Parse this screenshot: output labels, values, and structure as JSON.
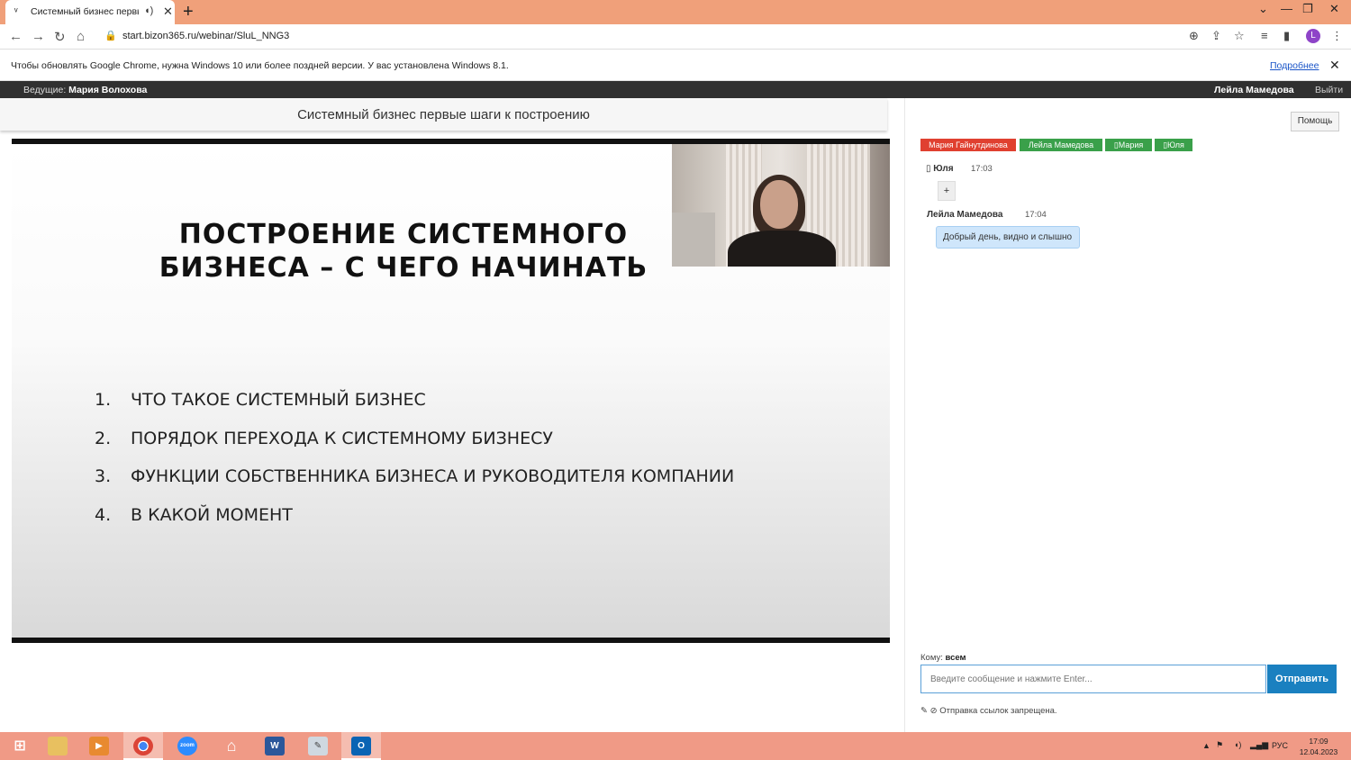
{
  "browser": {
    "tab_title": "Системный бизнес первые",
    "url": "start.bizon365.ru/webinar/SluL_NNG3",
    "profile_initial": "L",
    "infobar_message": "Чтобы обновлять Google Chrome, нужна Windows 10 или более поздней версии. У вас установлена Windows 8.1.",
    "infobar_link": "Подробнее"
  },
  "webinar_header": {
    "host_label": "Ведущие:",
    "host_name": "Мария Волохова",
    "current_user": "Лейла Мамедова",
    "exit_label": "Выйти"
  },
  "webinar_title": "Системный бизнес первые шаги к построению",
  "slide": {
    "heading_line1": "ПОСТРОЕНИЕ СИСТЕМНОГО",
    "heading_line2": "БИЗНЕСА – С ЧЕГО НАЧИНАТЬ",
    "items": [
      {
        "num": "1.",
        "text": "ЧТО ТАКОЕ СИСТЕМНЫЙ БИЗНЕС"
      },
      {
        "num": "2.",
        "text": "ПОРЯДОК ПЕРЕХОДА К СИСТЕМНОМУ БИЗНЕСУ"
      },
      {
        "num": "3.",
        "text": "ФУНКЦИИ СОБСТВЕННИКА БИЗНЕСА И РУКОВОДИТЕЛЯ КОМПАНИИ"
      },
      {
        "num": "4.",
        "text": "В КАКОЙ МОМЕНТ"
      }
    ]
  },
  "chat": {
    "help_label": "Помощь",
    "tags": [
      {
        "label": "Мария Гайнутдинова",
        "color": "#e04030"
      },
      {
        "label": "Лейла Мамедова",
        "color": "#3aa04a"
      },
      {
        "label": "▯Мария",
        "color": "#3aa04a"
      },
      {
        "label": "▯Юля",
        "color": "#3aa04a"
      }
    ],
    "messages": [
      {
        "author": "▯ Юля",
        "time": "17:03",
        "text": "+"
      },
      {
        "author": "Лейла Мамедова",
        "time": "17:04",
        "text": "Добрый день, видно и слышно"
      }
    ],
    "to_label": "Кому:",
    "to_value": "всем",
    "input_placeholder": "Введите сообщение и нажмите Enter...",
    "send_label": "Отправить",
    "note": "✎ ⊘ Отправка ссылок запрещена."
  },
  "taskbar": {
    "lang": "РУС",
    "time": "17:09",
    "date": "12.04.2023",
    "apps": [
      "windows-start",
      "file-explorer",
      "media-player",
      "chrome",
      "zoom",
      "home",
      "word",
      "paint",
      "outlook"
    ]
  }
}
